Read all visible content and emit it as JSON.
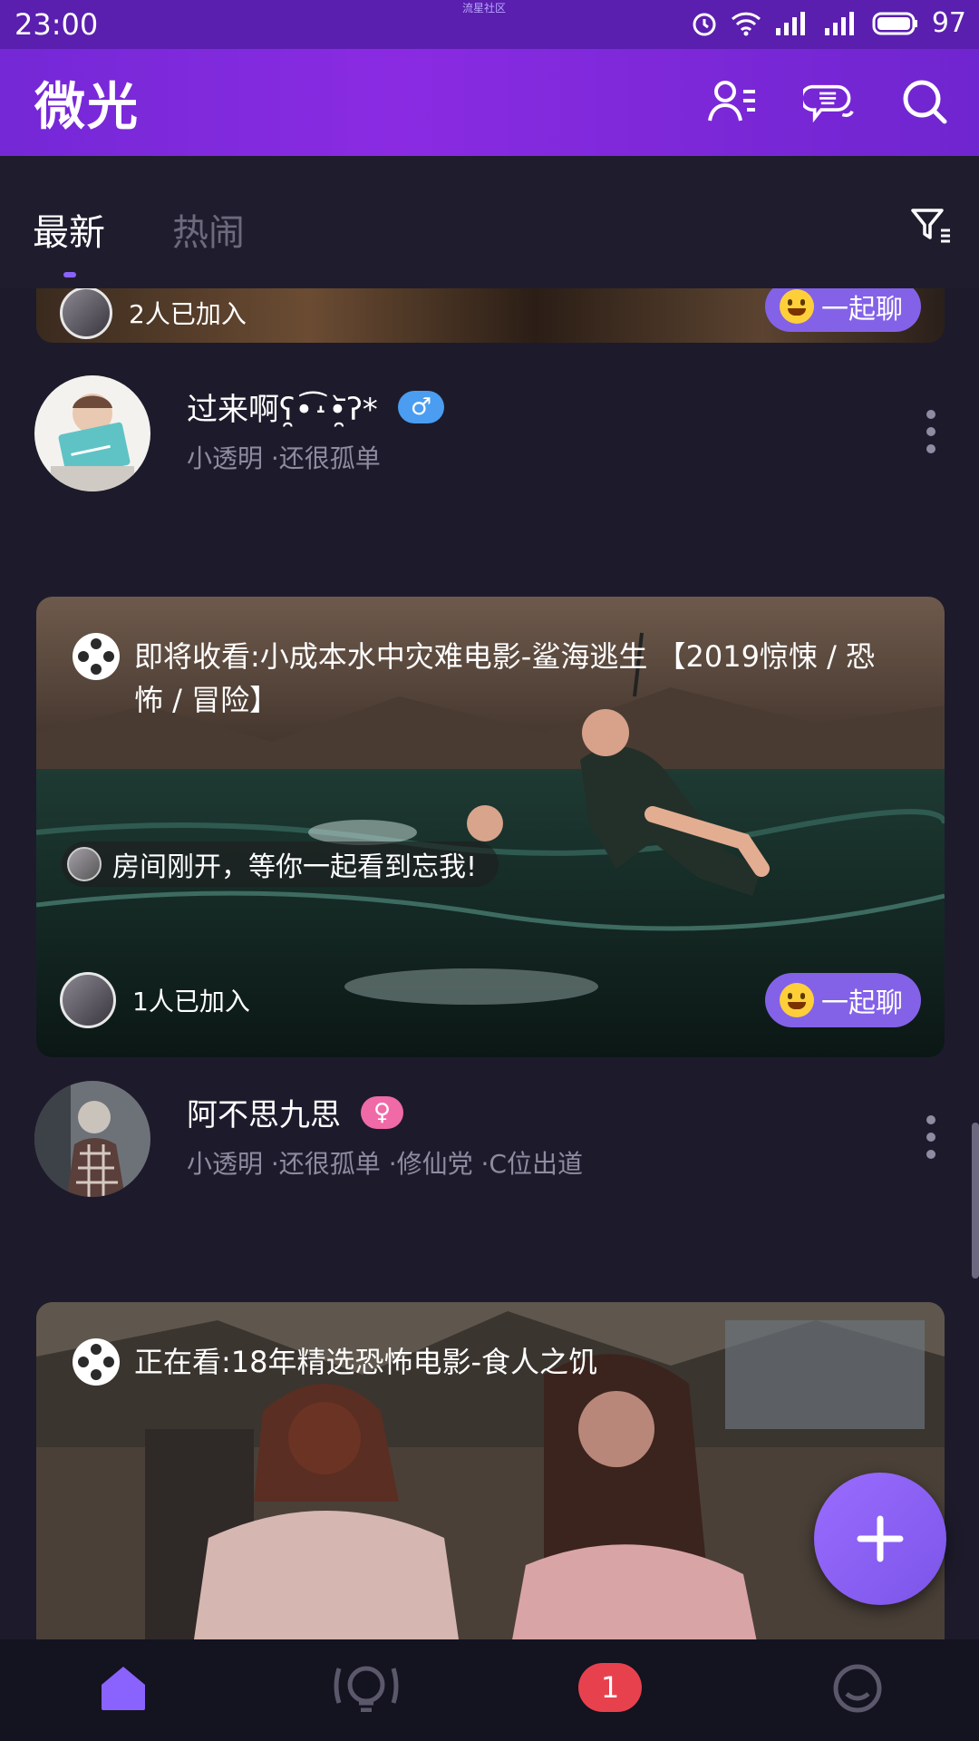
{
  "status_bar": {
    "time": "23:00",
    "center_text": "流星社区",
    "battery": "97"
  },
  "app": {
    "title": "微光"
  },
  "tabs": [
    {
      "label": "最新",
      "active": true
    },
    {
      "label": "热闹",
      "active": false
    }
  ],
  "feed": {
    "top_card": {
      "joined": "2人已加入",
      "chat": "一起聊"
    },
    "users": [
      {
        "name": "过来啊ʕ̯•͡˔•̯᷅ʔ*",
        "gender": "♂",
        "tags": "小透明 ·还很孤单"
      },
      {
        "name": "阿不思九思",
        "gender": "♀",
        "tags": "小透明 ·还很孤单 ·修仙党 ·C位出道"
      }
    ],
    "cards": [
      {
        "title": "即将收看:小成本水中灾难电影-鲨海逃生 【2019惊悚 / 恐怖 / 冒险】",
        "message": "房间刚开，等你一起看到忘我!",
        "joined": "1人已加入",
        "chat": "一起聊"
      },
      {
        "title": "正在看:18年精选恐怖电影-食人之饥"
      }
    ]
  },
  "bottom_nav": {
    "badge": "1"
  },
  "colors": {
    "primary": "#7a2fd8",
    "accent": "#8362e8",
    "background": "#1d1b2b",
    "badge": "#e8414e"
  }
}
